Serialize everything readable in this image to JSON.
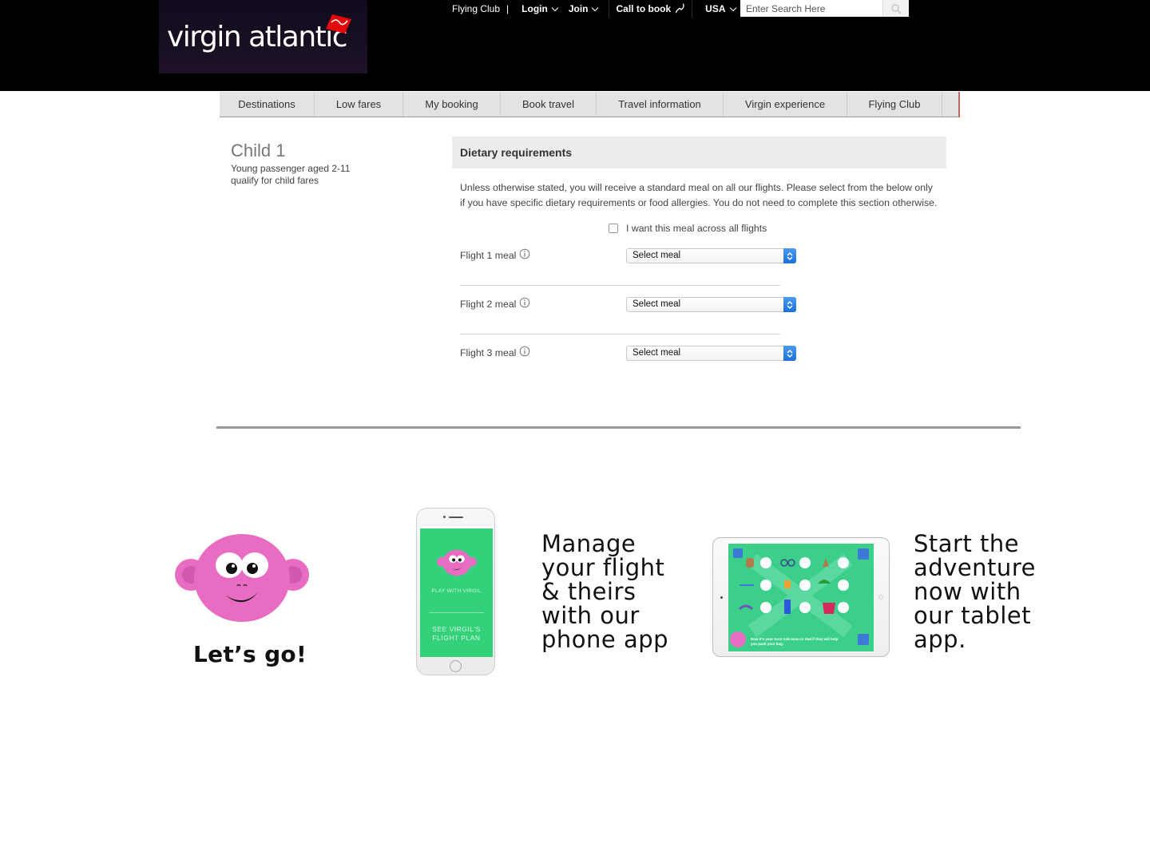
{
  "header": {
    "logo": "virgin atlantic",
    "topbar": {
      "flying_club": "Flying Club",
      "separator": "|",
      "login": "Login",
      "join": "Join",
      "call_to_book": "Call to book",
      "country": "USA"
    },
    "search": {
      "placeholder": "Enter Search Here"
    }
  },
  "nav": {
    "items": [
      {
        "label": "Destinations"
      },
      {
        "label": "Low fares"
      },
      {
        "label": "My booking"
      },
      {
        "label": "Book travel"
      },
      {
        "label": "Travel information"
      },
      {
        "label": "Virgin experience"
      },
      {
        "label": "Flying Club"
      }
    ]
  },
  "passenger": {
    "title": "Child 1",
    "description": "Young passenger aged 2-11 qualify for child fares"
  },
  "dietary": {
    "heading": "Dietary requirements",
    "intro": "Unless otherwise stated, you will receive a standard meal on all our flights. Please select from the below only if you have specific dietary requirements or food allergies. You do not need to complete this section otherwise.",
    "all_flights_label": "I want this meal across all flights",
    "all_flights_checked": false,
    "flights": [
      {
        "label": "Flight 1 meal",
        "selected": "Select meal"
      },
      {
        "label": "Flight 2 meal",
        "selected": "Select meal"
      },
      {
        "label": "Flight 3 meal",
        "selected": "Select meal"
      }
    ]
  },
  "promo": {
    "lets_go": "Let’s go!",
    "phone_app_text": "Manage\nyour flight\n& theirs\nwith our\nphone app",
    "phone_screen": {
      "play": "PLAY WITH VIRGIL",
      "plan": "SEE VIRGIL'S\nFLIGHT PLAN"
    },
    "tablet_app_text": "Start the\nadventure\nnow with\nour tablet\napp.",
    "tablet_screen": {
      "caption": "Now it's your turn! Ask mom or dad if they will help you pack your bag."
    }
  },
  "colors": {
    "brand_red": "#e10a0a",
    "monkey_pink": "#e86cc1",
    "app_green": "#33d27a",
    "select_blue": "#1a6fd8"
  }
}
